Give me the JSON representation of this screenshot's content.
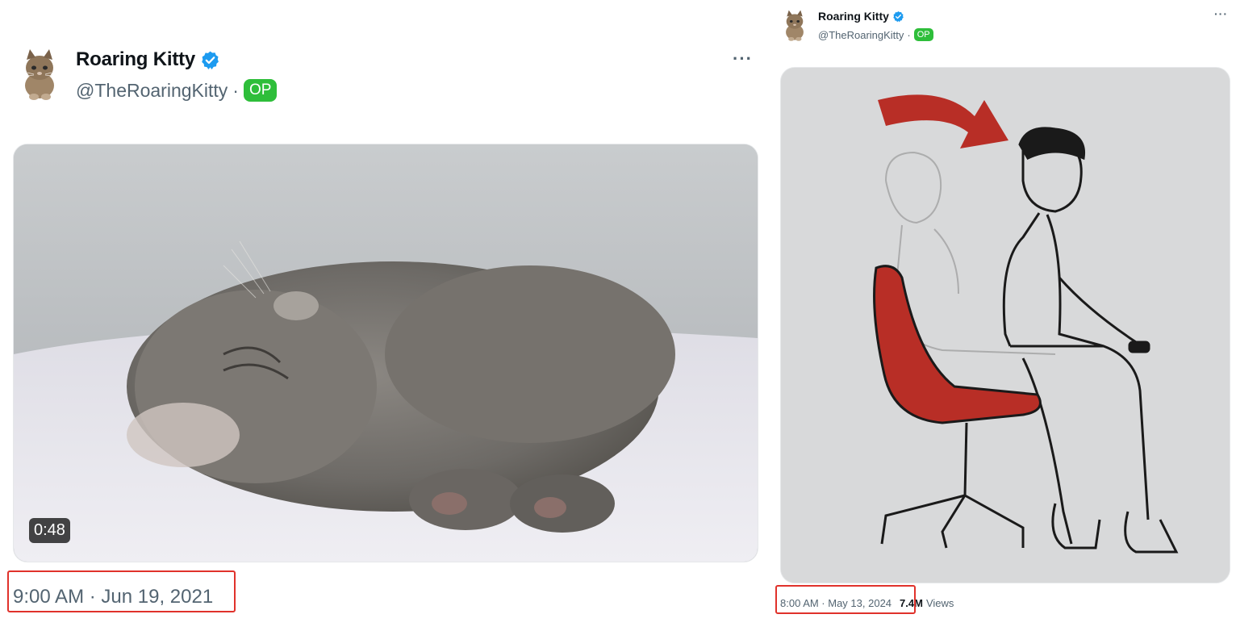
{
  "tweets": [
    {
      "author": {
        "display_name": "Roaring Kitty",
        "handle": "@TheRoaringKitty",
        "separator": "·",
        "badge": "OP",
        "avatar_icon": "kitten-avatar-icon",
        "verified_icon": "verified-badge-icon"
      },
      "more_icon": "more-options-icon",
      "more_label": "···",
      "media": {
        "type": "video-thumbnail",
        "duration": "0:48"
      },
      "timestamp": "9:00 AM · Jun 19, 2021"
    },
    {
      "author": {
        "display_name": "Roaring Kitty",
        "handle": "@TheRoaringKitty",
        "separator": "·",
        "badge": "OP",
        "avatar_icon": "kitten-avatar-icon",
        "verified_icon": "verified-badge-icon"
      },
      "more_icon": "more-options-icon",
      "more_label": "···",
      "media": {
        "type": "illustration"
      },
      "timestamp": "8:00 AM · May 13, 2024",
      "views_count": "7.4M",
      "views_label": "Views"
    }
  ],
  "colors": {
    "verified": "#1d9bf0",
    "op_badge": "#2ebe3a",
    "highlight": "#e0322b",
    "chair_red": "#b82e26"
  }
}
